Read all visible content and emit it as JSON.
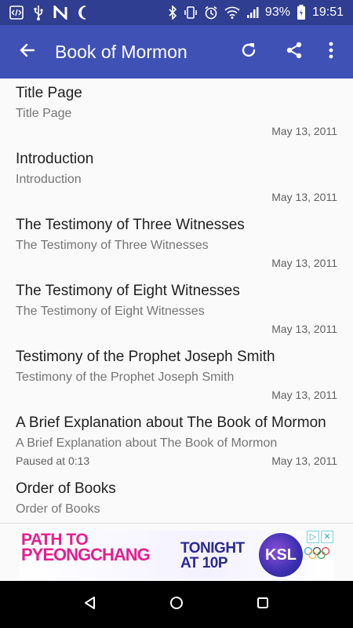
{
  "status_bar": {
    "battery_percent": "93%",
    "time": "19:51",
    "icons_left": [
      "code-icon",
      "usb-icon",
      "n-app-icon",
      "moon-icon"
    ],
    "icons_right": [
      "bluetooth-icon",
      "vibrate-icon",
      "alarm-icon",
      "wifi-icon",
      "signal-icon",
      "battery-icon"
    ]
  },
  "app_bar": {
    "title": "Book of Mormon",
    "back_icon": "arrow-left-icon",
    "actions": [
      "refresh-icon",
      "share-icon",
      "more-vert-icon"
    ]
  },
  "list": {
    "items": [
      {
        "title": "Title Page",
        "subtitle": "Title Page",
        "status": "",
        "date": "May 13, 2011"
      },
      {
        "title": "Introduction",
        "subtitle": "Introduction",
        "status": "",
        "date": "May 13, 2011"
      },
      {
        "title": "The Testimony of Three Witnesses",
        "subtitle": "The Testimony of Three Witnesses",
        "status": "",
        "date": "May 13, 2011"
      },
      {
        "title": "The Testimony of Eight Witnesses",
        "subtitle": "The Testimony of Eight Witnesses",
        "status": "",
        "date": "May 13, 2011"
      },
      {
        "title": "Testimony of the Prophet Joseph Smith",
        "subtitle": "Testimony of the Prophet Joseph Smith",
        "status": "",
        "date": "May 13, 2011"
      },
      {
        "title": "A Brief Explanation about The Book of Mormon",
        "subtitle": "A Brief Explanation about The Book of Mormon",
        "status": "Paused at 0:13",
        "date": "May 13, 2011"
      },
      {
        "title": "Order of Books",
        "subtitle": "Order of Books",
        "status": "",
        "date": ""
      }
    ]
  },
  "ad": {
    "headline_line1": "PATH TO",
    "headline_line2": "PYEONGCHANG",
    "tagline_line1": "TONIGHT",
    "tagline_line2": "AT 10P",
    "logo_text": "KSL",
    "colors": {
      "headline": "#e3208f",
      "tagline": "#2b2b8e"
    }
  },
  "nav_bar": {
    "buttons": [
      "back-triangle-icon",
      "home-circle-icon",
      "recents-square-icon"
    ]
  },
  "colors": {
    "app_bar": "#3f51b5",
    "status_bar": "#2f3e90",
    "title_text": "#212121",
    "subtitle_text": "#757575"
  }
}
